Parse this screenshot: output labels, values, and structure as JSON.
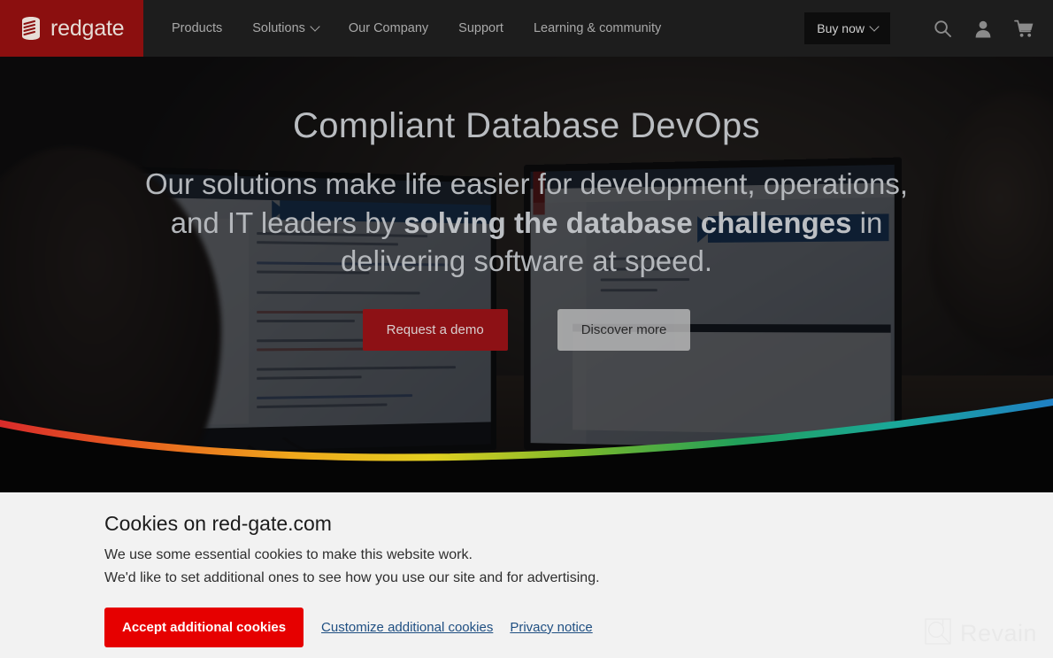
{
  "site": {
    "brand": "redgate",
    "logo_icon": "database-stripes-icon",
    "brand_red": "#8b0f0f"
  },
  "header": {
    "nav": [
      {
        "label": "Products",
        "icon": null
      },
      {
        "label": "Solutions",
        "icon": "chevron-down-icon"
      },
      {
        "label": "Our Company",
        "icon": null
      },
      {
        "label": "Support",
        "icon": null
      },
      {
        "label": "Learning & community",
        "icon": null
      }
    ],
    "buy_now": {
      "label": "Buy now",
      "icon": "chevron-down-icon"
    },
    "icons": [
      {
        "name": "search-icon",
        "label": "Search"
      },
      {
        "name": "account-icon",
        "label": "Account"
      },
      {
        "name": "cart-icon",
        "label": "Cart"
      }
    ],
    "background": "#1d1d1d"
  },
  "hero": {
    "title": "Compliant Database DevOps",
    "subtitle_parts": [
      {
        "text": "Our solutions make life easier for development, operations, and IT leaders by ",
        "bold": false
      },
      {
        "text": "solving the database challenges",
        "bold": true
      },
      {
        "text": " in delivering software at speed.",
        "bold": false
      }
    ],
    "subtitle_plain": "Our solutions make life easier for development, operations, and IT leaders by solving the database challenges in delivering software at speed.",
    "primary_button": {
      "label": "Request a demo",
      "color": "#8d1115"
    },
    "secondary_button": {
      "label": "Discover more",
      "color": "#b9b9b9"
    },
    "background_description": "Darkened photo of a developer working at dual monitors showing database tooling",
    "divider": {
      "name": "rainbow-curve-divider",
      "colors": [
        "#d92b2b",
        "#e8601f",
        "#efa81c",
        "#e3d020",
        "#7ab82b",
        "#22a05a",
        "#1aa89a",
        "#1f7fc4"
      ]
    }
  },
  "cookie_banner": {
    "title": "Cookies on red-gate.com",
    "lines": [
      "We use some essential cookies to make this website work.",
      "We'd like to set additional ones to see how you use our site and for advertising."
    ],
    "accept_button": {
      "label": "Accept additional cookies",
      "color": "#e60000"
    },
    "links": [
      {
        "label": "Customize additional cookies"
      },
      {
        "label": "Privacy notice"
      }
    ],
    "background": "#f2f2f2"
  },
  "watermark": {
    "text": "Revain",
    "icon": "revain-logo-icon"
  }
}
